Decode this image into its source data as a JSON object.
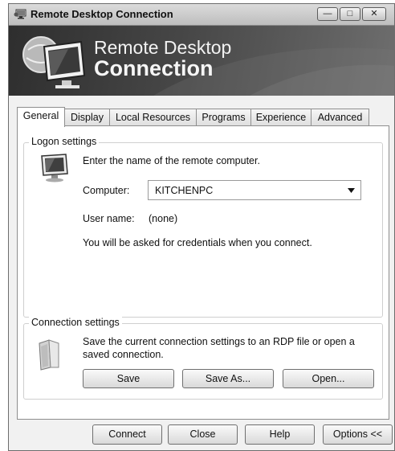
{
  "window": {
    "title": "Remote Desktop Connection",
    "controls": {
      "minimize": "—",
      "maximize": "□",
      "close": "✕"
    }
  },
  "banner": {
    "line1": "Remote Desktop",
    "line2": "Connection"
  },
  "tabs": [
    {
      "label": "General",
      "active": true
    },
    {
      "label": "Display",
      "active": false
    },
    {
      "label": "Local Resources",
      "active": false
    },
    {
      "label": "Programs",
      "active": false
    },
    {
      "label": "Experience",
      "active": false
    },
    {
      "label": "Advanced",
      "active": false
    }
  ],
  "logon": {
    "group_label": "Logon settings",
    "intro": "Enter the name of the remote computer.",
    "computer_label": "Computer:",
    "computer_value": "KITCHENPC",
    "username_label": "User name:",
    "username_value": "(none)",
    "note": "You will be asked for credentials when you connect."
  },
  "connection": {
    "group_label": "Connection settings",
    "desc_line1": "Save the current connection settings to an RDP file or open a",
    "desc_line2": "saved connection.",
    "save": "Save",
    "save_as": "Save As...",
    "open": "Open..."
  },
  "footer": {
    "connect": "Connect",
    "close": "Close",
    "help": "Help",
    "options": "Options <<"
  }
}
